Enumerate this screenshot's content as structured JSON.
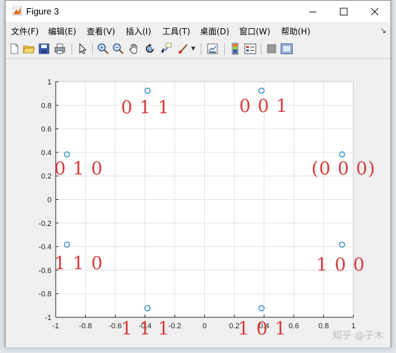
{
  "window": {
    "title": "Figure 3"
  },
  "menu": [
    "文件(F)",
    "编辑(E)",
    "查看(V)",
    "插入(I)",
    "工具(T)",
    "桌面(D)",
    "窗口(W)",
    "帮助(H)"
  ],
  "toolbar_icons": [
    "new-figure-icon",
    "open-file-icon",
    "save-icon",
    "print-icon",
    "select-arrow-icon",
    "zoom-in-icon",
    "zoom-out-icon",
    "pan-hand-icon",
    "rotate-3d-icon",
    "data-cursor-icon",
    "brush-icon",
    "link-plot-icon",
    "colorbar-icon",
    "legend-icon",
    "hide-plot-tools-icon",
    "show-plot-tools-icon"
  ],
  "chart_data": {
    "type": "scatter",
    "xlim": [
      -1,
      1
    ],
    "ylim": [
      -1,
      1
    ],
    "xticks": [
      "-1",
      "-0.8",
      "-0.6",
      "-0.4",
      "-0.2",
      "0",
      "0.2",
      "0.4",
      "0.6",
      "0.8",
      "1"
    ],
    "yticks": [
      "1",
      "0.8",
      "0.6",
      "0.4",
      "0.2",
      "0",
      "-0.2",
      "-0.4",
      "-0.6",
      "-0.8",
      "-1"
    ],
    "grid": true,
    "marker": "circle",
    "marker_color": "#0072bd",
    "points": [
      {
        "x": 0.924,
        "y": 0.383
      },
      {
        "x": 0.383,
        "y": 0.924
      },
      {
        "x": -0.383,
        "y": 0.924
      },
      {
        "x": -0.924,
        "y": 0.383
      },
      {
        "x": -0.924,
        "y": -0.383
      },
      {
        "x": -0.383,
        "y": -0.924
      },
      {
        "x": 0.383,
        "y": -0.924
      },
      {
        "x": 0.924,
        "y": -0.383
      }
    ],
    "annotations": [
      {
        "text": "0 1 1",
        "color": "#d83a3a"
      },
      {
        "text": "0 0 1",
        "color": "#d83a3a"
      },
      {
        "text": "0 1 0",
        "color": "#d83a3a"
      },
      {
        "text": "(0 0 0)",
        "color": "#d83a3a"
      },
      {
        "text": "1 1 0",
        "color": "#d83a3a"
      },
      {
        "text": "1 0 0",
        "color": "#d83a3a"
      },
      {
        "text": "1 1 1",
        "color": "#d83a3a"
      },
      {
        "text": "1 0 1",
        "color": "#d83a3a"
      }
    ]
  },
  "watermark": "知乎 @子木"
}
